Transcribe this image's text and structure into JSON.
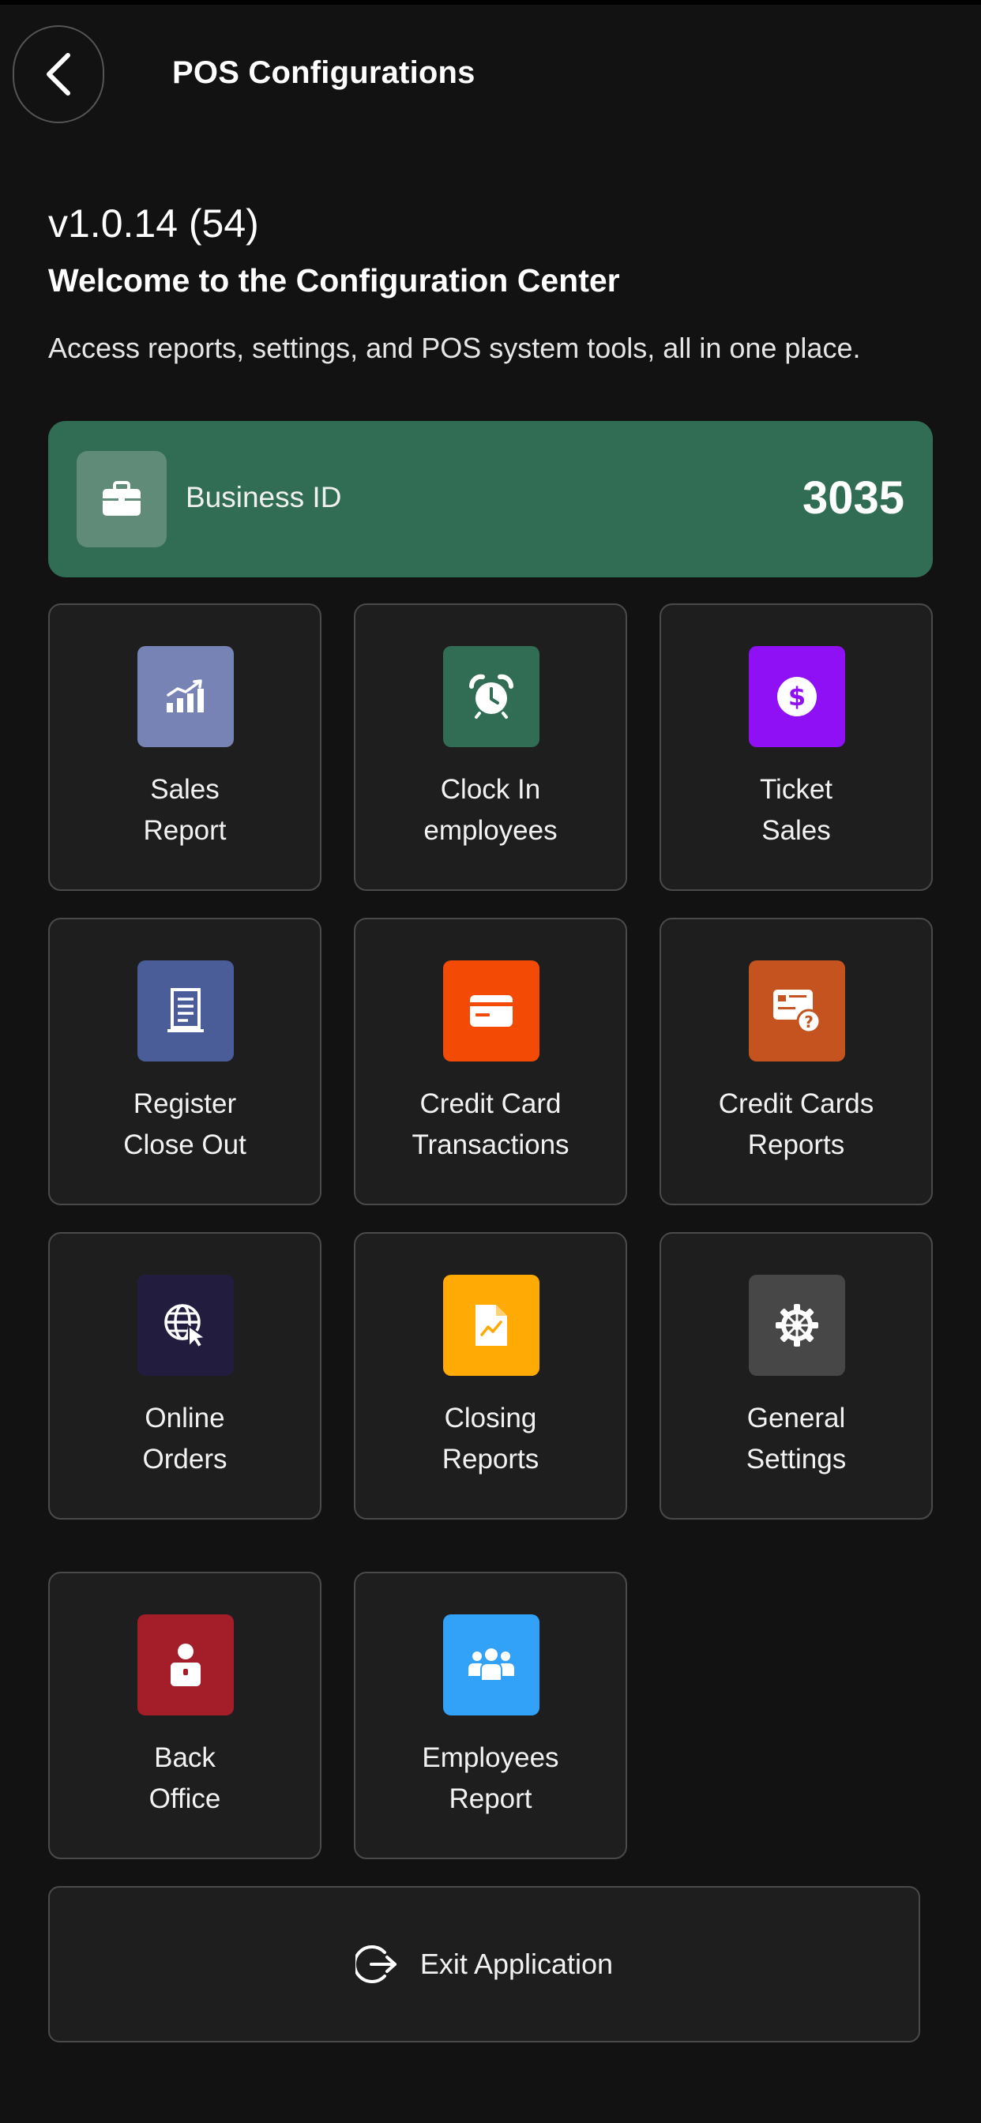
{
  "header": {
    "title": "POS Configurations",
    "back_icon": "chevron-left-icon"
  },
  "intro": {
    "version": "v1.0.14 (54)",
    "welcome": "Welcome to the Configuration Center",
    "subtitle": "Access reports, settings, and POS system tools, all in one place."
  },
  "business": {
    "label": "Business ID",
    "value": "3035",
    "icon": "briefcase-icon",
    "color": "#316d55"
  },
  "tiles": [
    {
      "line1": "Sales",
      "line2": "Report",
      "icon": "sales-chart-icon",
      "color": "#7683b4"
    },
    {
      "line1": "Clock In",
      "line2": "employees",
      "icon": "alarm-clock-icon",
      "color": "#316d55"
    },
    {
      "line1": "Ticket",
      "line2": "Sales",
      "icon": "dollar-coin-icon",
      "color": "#8f10f5"
    },
    {
      "line1": "Register",
      "line2": "Close Out",
      "icon": "receipt-icon",
      "color": "#4a5d98"
    },
    {
      "line1": "Credit Card",
      "line2": "Transactions",
      "icon": "credit-card-icon",
      "color": "#f34a05"
    },
    {
      "line1": "Credit Cards",
      "line2": "Reports",
      "icon": "card-question-icon",
      "color": "#c4531f"
    },
    {
      "line1": "Online",
      "line2": "Orders",
      "icon": "globe-cursor-icon",
      "color": "#221d3f"
    },
    {
      "line1": "Closing",
      "line2": "Reports",
      "icon": "document-chart-icon",
      "color": "#ffaa05"
    },
    {
      "line1": "General",
      "line2": "Settings",
      "icon": "gear-icon",
      "color": "#474747"
    },
    {
      "line1": "Back",
      "line2": "Office",
      "icon": "office-user-icon",
      "color": "#a31e28"
    },
    {
      "line1": "Employees",
      "line2": "Report",
      "icon": "people-icon",
      "color": "#32a1f8"
    }
  ],
  "exit": {
    "label": "Exit Application",
    "icon": "exit-icon"
  }
}
